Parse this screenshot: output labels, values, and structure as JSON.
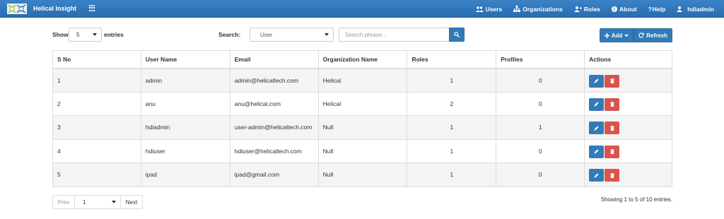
{
  "app": {
    "title": "Helical Insight"
  },
  "nav": {
    "users": "Users",
    "organizations": "Organizations",
    "roles": "Roles",
    "about": "About",
    "help": "Help",
    "user": "hdiadmin"
  },
  "toolbar": {
    "show_label": "Show",
    "page_size": "5",
    "entries_label": "entries",
    "search_label": "Search:",
    "search_type": "User",
    "search_placeholder": "Search phrase...",
    "add_label": "Add",
    "refresh_label": "Refresh"
  },
  "table": {
    "headers": [
      "S No",
      "User Name",
      "Email",
      "Organization Name",
      "Roles",
      "Profiles",
      "Actions"
    ],
    "rows": [
      [
        "1",
        "admin",
        "admin@helicaltech.com",
        "Helical",
        "1",
        "0"
      ],
      [
        "2",
        "anu",
        "anu@helical.com",
        "Helical",
        "2",
        "0"
      ],
      [
        "3",
        "hdiadmin",
        "user-admin@helicaltech.com",
        "Null",
        "1",
        "1"
      ],
      [
        "4",
        "hdiuser",
        "hdiuser@helicaltech.com",
        "Null",
        "1",
        "0"
      ],
      [
        "5",
        "ipad",
        "ipad@gmail.com",
        "Null",
        "1",
        "0"
      ]
    ]
  },
  "pagination": {
    "prev": "Prev",
    "page": "1",
    "next": "Next",
    "summary": "Showing 1 to 5 of 10 entries."
  },
  "colors": {
    "navbar": "#2f76bb",
    "primary": "#337ab7",
    "danger": "#d9534f"
  },
  "icons": [
    "logo-icon",
    "apps-grid-icon",
    "users-icon",
    "organizations-icon",
    "roles-icon",
    "info-icon",
    "help-icon",
    "user-icon",
    "search-icon",
    "plus-icon",
    "refresh-icon",
    "pencil-icon",
    "trash-icon"
  ]
}
